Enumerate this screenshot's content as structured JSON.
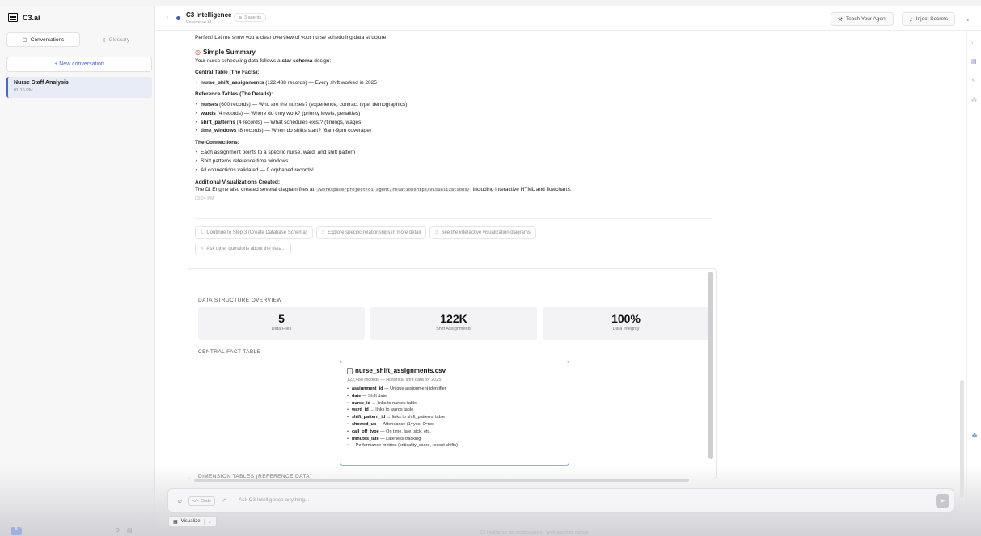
{
  "sidebar": {
    "brand": "C3.ai",
    "tabs": [
      {
        "label": "Conversations",
        "icon": "chat-bubble-icon"
      },
      {
        "label": "Glossary",
        "icon": "book-icon"
      }
    ],
    "new_conversation": "+ New conversation",
    "conversations": [
      {
        "title": "Nurse Staff Analysis",
        "time": "01:16 PM"
      }
    ],
    "user_initial": "A"
  },
  "header": {
    "title": "C3 Intelligence",
    "subtitle": "Enterprise AI",
    "agents_badge": "3 agents",
    "teach_button": "Teach Your Agent",
    "inject_button": "Inject Secrets"
  },
  "chat": {
    "intro": "Perfect! Let me show you a clear overview of your nurse scheduling data structure.",
    "summary_heading": "Simple Summary",
    "schema_line_pre": "Your nurse scheduling data follows a ",
    "schema_line_bold": "star schema",
    "schema_line_post": " design:",
    "central_heading": "Central Table (The Facts):",
    "central_items": [
      {
        "name": "nurse_shift_assignments",
        "desc": " (122,488 records) — Every shift worked in 2025"
      }
    ],
    "reference_heading": "Reference Tables (The Details):",
    "reference_items": [
      {
        "name": "nurses",
        "desc": " (600 records) — Who are the nurses? (experience, contract type, demographics)"
      },
      {
        "name": "wards",
        "desc": " (4 records) — Where do they work? (priority levels, penalties)"
      },
      {
        "name": "shift_patterns",
        "desc": " (4 records) — What schedules exist? (timings, wages)"
      },
      {
        "name": "time_windows",
        "desc": " (8 records) — When do shifts start? (6am-9pm coverage)"
      }
    ],
    "connections_heading": "The Connections:",
    "connections": [
      "Each assignment points to a specific nurse, ward, and shift pattern",
      "Shift patterns reference time windows",
      "All connections validated — 0 orphaned records!"
    ],
    "additional_heading": "Additional Visualizations Created:",
    "additional_pre": "The DI Engine also created several diagram files at ",
    "additional_path": "/workspace/project/di_agent/relationships/visualizations/",
    "additional_post": " including interactive HTML and flowcharts.",
    "time": "03:24 PM",
    "suggestions": [
      {
        "n": "1",
        "label": "Continue to Step 3 (Create Database Schema)"
      },
      {
        "n": "2",
        "label": "Explore specific relationships in more detail"
      },
      {
        "n": "3",
        "label": "See the interactive visualization diagrams"
      },
      {
        "n": "4",
        "label": "Ask other questions about the data..."
      }
    ]
  },
  "viz": {
    "overview_title": "DATA STRUCTURE OVERVIEW",
    "stats": [
      {
        "value": "5",
        "label": "Data Files"
      },
      {
        "value": "122K",
        "label": "Shift Assignments"
      },
      {
        "value": "100%",
        "label": "Data Integrity"
      }
    ],
    "fact_title": "CENTRAL FACT TABLE",
    "fact_file": "nurse_shift_assignments.csv",
    "fact_sub": "122,488 records — Historical shift data for 2025",
    "fields": [
      {
        "name": "assignment_id",
        "desc": " — Unique assignment identifier"
      },
      {
        "name": "date",
        "desc": " — Shift date"
      },
      {
        "name": "nurse_id",
        "desc": " → links to nurses table"
      },
      {
        "name": "ward_id",
        "desc": " → links to wards table"
      },
      {
        "name": "shift_pattern_id",
        "desc": " → links to shift_patterns table"
      },
      {
        "name": "showed_up",
        "desc": " — Attendance (1=yes, 0=no)"
      },
      {
        "name": "call_off_type",
        "desc": " — On time, late, sick, etc."
      },
      {
        "name": "minutes_late",
        "desc": " — Lateness tracking"
      },
      {
        "name": "",
        "desc": "+ Performance metrics (criticality_score, recent shifts)"
      }
    ],
    "dimension_title": "DIMENSION TABLES (REFERENCE DATA)"
  },
  "composer": {
    "code_label": "Code",
    "placeholder": "Ask C3 Intelligence anything...",
    "visualize_label": "Visualize",
    "footer_note": "C3 Intelligence can produce errors · Verify important outputs"
  }
}
